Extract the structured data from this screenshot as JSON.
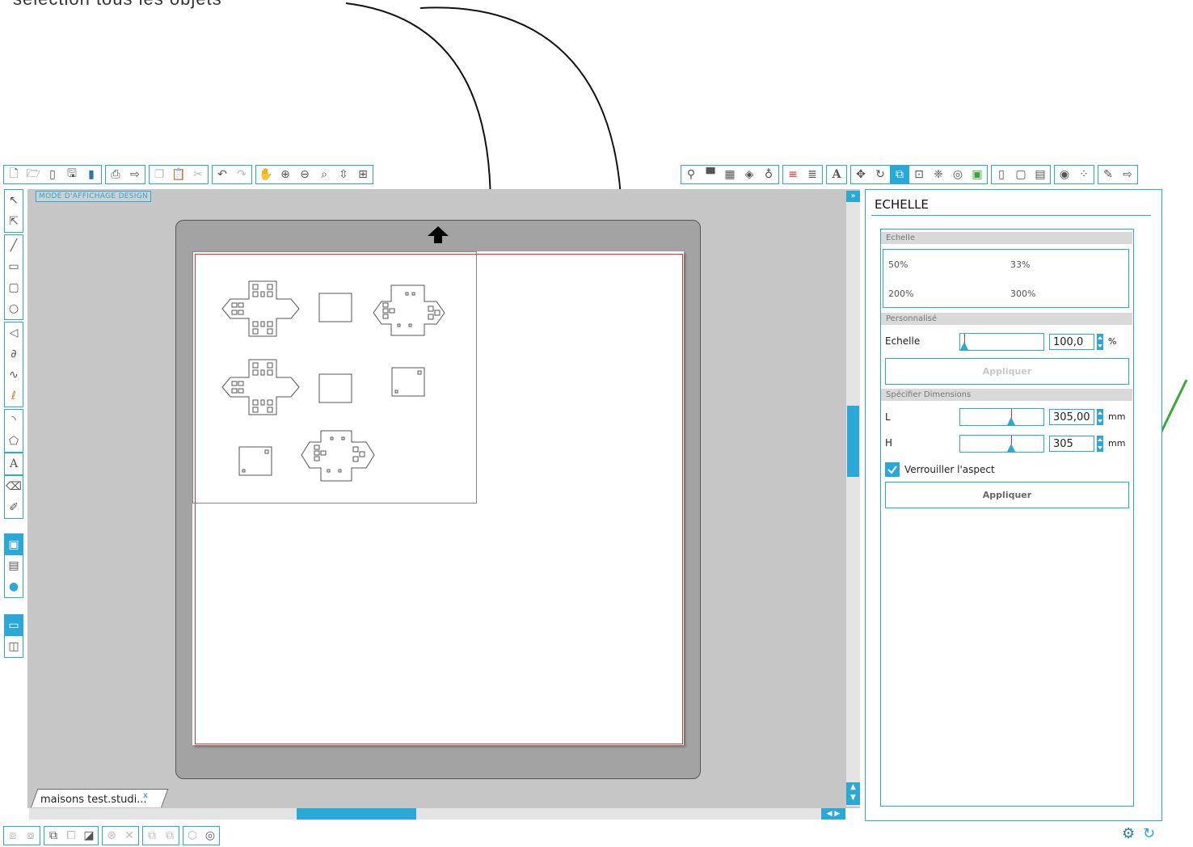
{
  "annotation": {
    "text": "sélection tous les objets"
  },
  "top_toolbar_left": {
    "groups": [
      [
        "new-document-icon",
        "open-icon",
        "open-library-icon",
        "save-icon",
        "save-as-icon"
      ],
      [
        "print-icon",
        "send-to-cutter-icon"
      ],
      [
        "copy-icon",
        "paste-icon",
        "cut-icon"
      ],
      [
        "undo-icon",
        "redo-icon"
      ],
      [
        "pan-hand-icon",
        "zoom-in-icon",
        "zoom-out-icon",
        "zoom-select-icon",
        "zoom-fit-icon",
        "zoom-page-icon"
      ]
    ]
  },
  "top_toolbar_right": {
    "groups": [
      [
        "fill-color-icon",
        "fill-gradient-icon",
        "fill-pattern-icon",
        "fill-panel-icon",
        "line-color-icon"
      ],
      [
        "line-style-icon",
        "line-weight-icon"
      ],
      [
        "text-style-icon"
      ],
      [
        "transform-icon",
        "rotate-icon",
        "scale-icon",
        "move-icon",
        "replicate-icon",
        "offset-icon",
        "trace-icon"
      ],
      [
        "page-setup-icon",
        "registration-icon",
        "grid-icon"
      ],
      [
        "library-icon",
        "design-store-icon"
      ],
      [
        "sketch-icon",
        "send-icon"
      ]
    ],
    "active": "scale-icon"
  },
  "canvas": {
    "mode_label": "MODE D'AFFICHAGE DESIGN",
    "doc_tab": "maisons test.studi...",
    "doc_tab_close": "x"
  },
  "panel": {
    "title": "ECHELLE",
    "section_scale": "Echelle",
    "presets": [
      "50%",
      "33%",
      "200%",
      "300%"
    ],
    "section_custom": "Personnalisé",
    "scale_label": "Echelle",
    "scale_value": "100,0",
    "scale_unit": "%",
    "scale_slider_pct": 5,
    "apply_label": "Appliquer",
    "section_dims": "Spécifier Dimensions",
    "width_label": "L",
    "width_value": "305,00",
    "width_slider_pct": 61,
    "height_label": "H",
    "height_value": "305",
    "height_slider_pct": 61,
    "dim_unit": "mm",
    "lock_aspect_label": "Verrouiller l'aspect",
    "lock_aspect_checked": true,
    "apply_dims_label": "Appliquer"
  },
  "colors": {
    "accent": "#2aa8d8",
    "cross_red": "#d9262a",
    "check_green": "#3aa93a"
  }
}
